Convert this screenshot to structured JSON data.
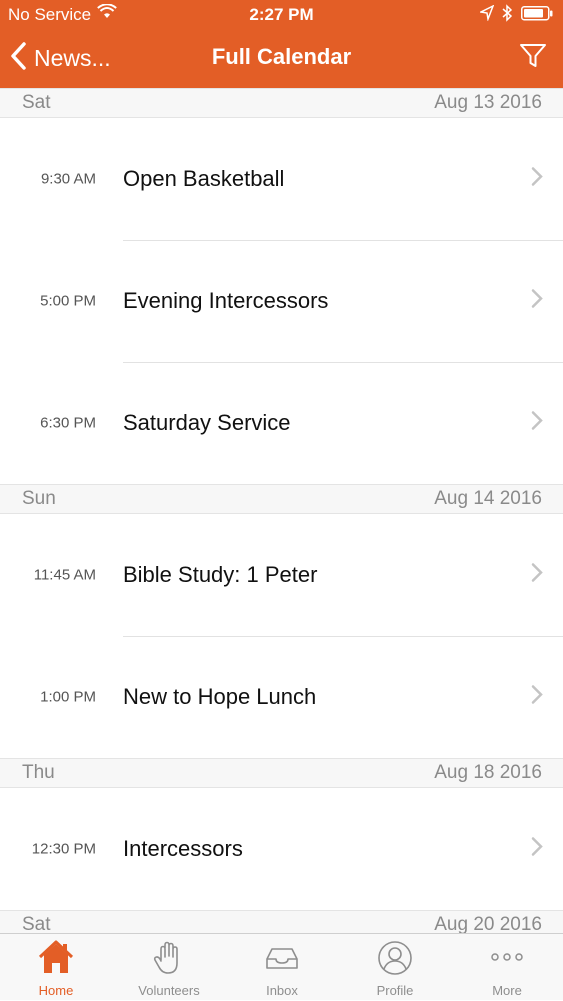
{
  "colors": {
    "accent": "#e35e26",
    "section_bg": "#f7f7f7",
    "tab_inactive": "#8e8e8e"
  },
  "status_bar": {
    "carrier": "No Service",
    "time": "2:27 PM"
  },
  "nav": {
    "back_label": "News...",
    "title": "Full Calendar",
    "filter_icon": "filter-icon"
  },
  "sections": [
    {
      "day": "Sat",
      "date": "Aug 13 2016",
      "events": [
        {
          "time": "9:30 AM",
          "title": "Open Basketball"
        },
        {
          "time": "5:00 PM",
          "title": "Evening Intercessors"
        },
        {
          "time": "6:30 PM",
          "title": "Saturday Service"
        }
      ]
    },
    {
      "day": "Sun",
      "date": "Aug 14 2016",
      "events": [
        {
          "time": "11:45 AM",
          "title": "Bible Study: 1 Peter"
        },
        {
          "time": "1:00 PM",
          "title": "New to Hope Lunch"
        }
      ]
    },
    {
      "day": "Thu",
      "date": "Aug 18 2016",
      "events": [
        {
          "time": "12:30 PM",
          "title": "Intercessors"
        }
      ]
    },
    {
      "day": "Sat",
      "date": "Aug 20 2016",
      "events": []
    }
  ],
  "tabs": [
    {
      "label": "Home",
      "icon": "home-icon",
      "active": true
    },
    {
      "label": "Volunteers",
      "icon": "hand-icon",
      "active": false
    },
    {
      "label": "Inbox",
      "icon": "inbox-icon",
      "active": false
    },
    {
      "label": "Profile",
      "icon": "profile-icon",
      "active": false
    },
    {
      "label": "More",
      "icon": "more-icon",
      "active": false
    }
  ]
}
